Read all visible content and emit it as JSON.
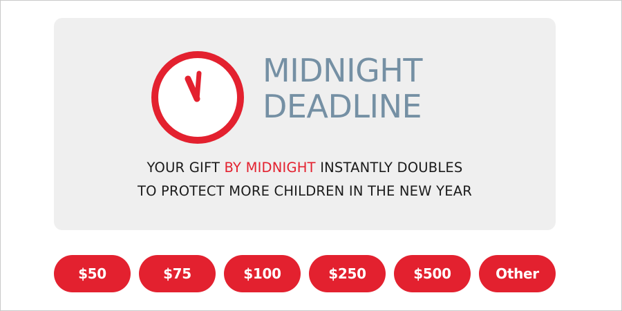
{
  "colors": {
    "accent": "#e3212f",
    "headline": "#7590a4",
    "card_background": "#efefef",
    "text": "#1b1b1b"
  },
  "clock": {
    "icon": "clock-icon"
  },
  "headline": {
    "line1": "MIDNIGHT",
    "line2": "DEADLINE"
  },
  "message": {
    "line1_before": "YOUR GIFT ",
    "line1_highlight": "BY MIDNIGHT",
    "line1_after": " INSTANTLY DOUBLES",
    "line2": "TO PROTECT MORE CHILDREN IN THE NEW YEAR"
  },
  "amounts": [
    {
      "label": "$50"
    },
    {
      "label": "$75"
    },
    {
      "label": "$100"
    },
    {
      "label": "$250"
    },
    {
      "label": "$500"
    },
    {
      "label": "Other"
    }
  ]
}
